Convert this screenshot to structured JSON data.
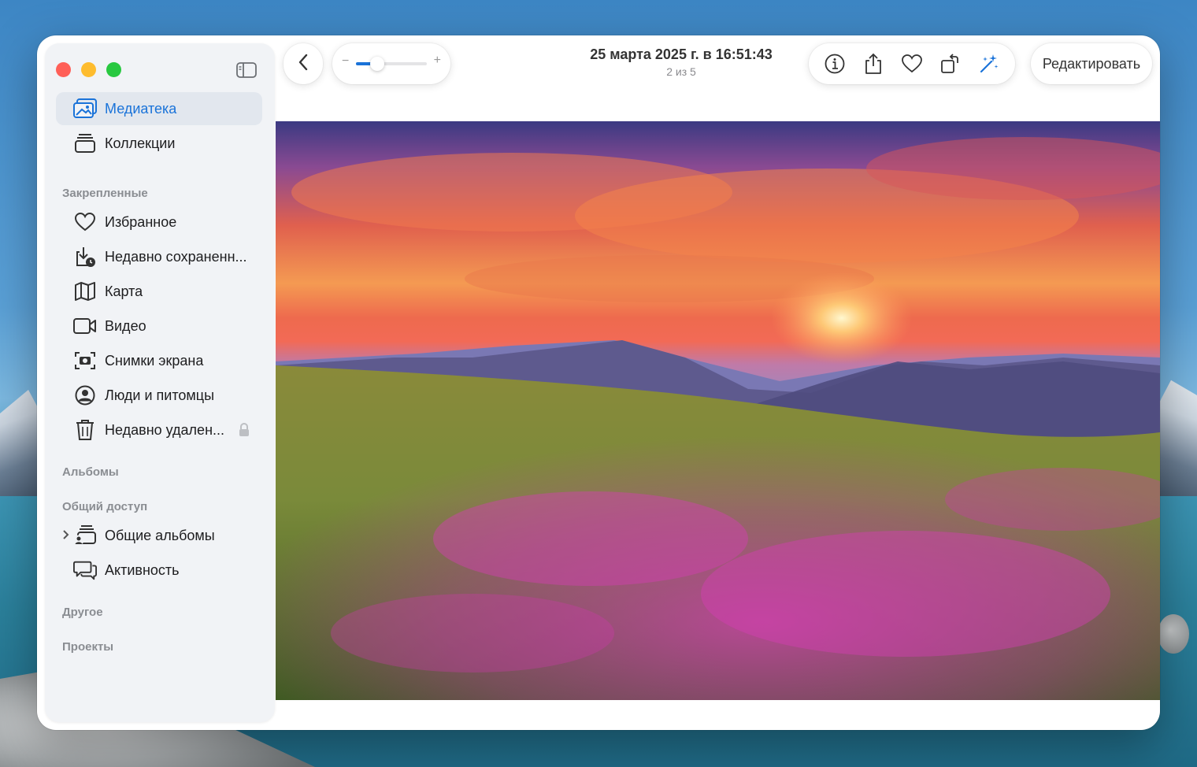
{
  "window": {
    "title": "25 марта 2025 г. в 16:51:43",
    "subtitle": "2 из 5"
  },
  "sidebar": {
    "items": [
      {
        "label": "Медиатека",
        "icon": "photo-library-icon",
        "selected": true
      },
      {
        "label": "Коллекции",
        "icon": "collections-icon"
      }
    ],
    "sections": {
      "pinned": "Закрепленные",
      "albums": "Альбомы",
      "shared": "Общий доступ",
      "other": "Другое",
      "projects": "Проекты"
    },
    "pinned_items": [
      {
        "label": "Избранное",
        "icon": "heart-icon"
      },
      {
        "label": "Недавно сохраненн...",
        "icon": "recently-saved-icon"
      },
      {
        "label": "Карта",
        "icon": "map-icon"
      },
      {
        "label": "Видео",
        "icon": "video-icon"
      },
      {
        "label": "Снимки экрана",
        "icon": "screenshot-icon"
      },
      {
        "label": "Люди и питомцы",
        "icon": "person-icon"
      },
      {
        "label": "Недавно удален...",
        "icon": "trash-icon"
      }
    ],
    "shared_items": [
      {
        "label": "Общие альбомы",
        "icon": "shared-albums-icon"
      },
      {
        "label": "Активность",
        "icon": "activity-icon"
      }
    ]
  },
  "toolbar": {
    "zoom_minus": "−",
    "zoom_plus": "+",
    "zoom_level": 0.3,
    "edit_label": "Редактировать"
  },
  "colors": {
    "accent": "#1a73d9",
    "close": "#ff5f57",
    "minimize": "#febc2e",
    "zoom": "#28c840"
  }
}
